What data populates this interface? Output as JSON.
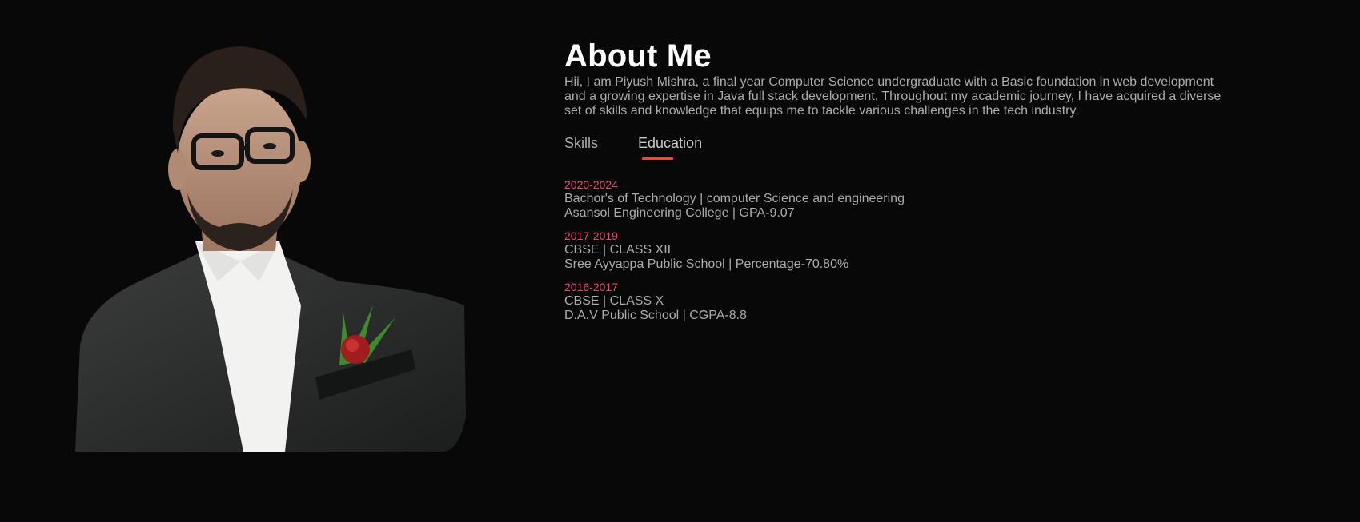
{
  "about": {
    "title": "About Me",
    "intro": "Hii, I am Piyush Mishra, a final year Computer Science undergraduate with a Basic foundation in web development and a growing expertise in Java full stack development. Throughout my academic journey, I have acquired a diverse set of skills and knowledge that equips me to tackle various challenges in the tech industry."
  },
  "tabs": [
    {
      "label": "Skills",
      "active": false
    },
    {
      "label": "Education",
      "active": true
    }
  ],
  "education": [
    {
      "year": "2020-2024",
      "line1": "Bachor's of Technology | computer Science and engineering",
      "line2": "Asansol Engineering College | GPA-9.07"
    },
    {
      "year": "2017-2019",
      "line1": "CBSE | CLASS XII",
      "line2": "Sree Ayyappa Public School | Percentage-70.80%"
    },
    {
      "year": "2016-2017",
      "line1": "CBSE | CLASS X",
      "line2": "D.A.V Public School | CGPA-8.8"
    }
  ],
  "colors": {
    "background": "#080808",
    "accent": "#e74c3c",
    "year": "#e44a6e",
    "text": "#ababab",
    "heading": "#ffffff"
  }
}
